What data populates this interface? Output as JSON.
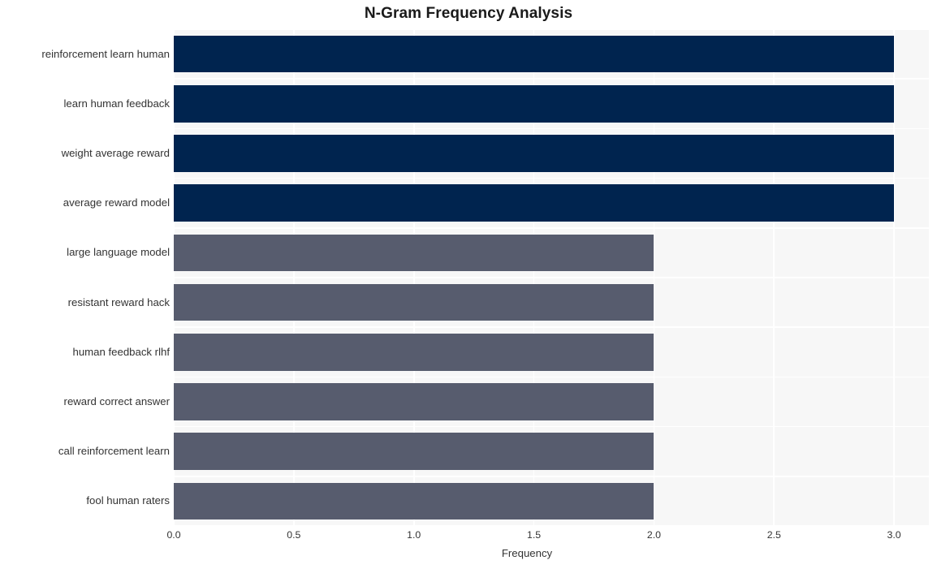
{
  "chart_data": {
    "type": "bar",
    "orientation": "horizontal",
    "title": "N-Gram Frequency Analysis",
    "xlabel": "Frequency",
    "ylabel": "",
    "categories": [
      "reinforcement learn human",
      "learn human feedback",
      "weight average reward",
      "average reward model",
      "large language model",
      "resistant reward hack",
      "human feedback rlhf",
      "reward correct answer",
      "call reinforcement learn",
      "fool human raters"
    ],
    "values": [
      3,
      3,
      3,
      3,
      2,
      2,
      2,
      2,
      2,
      2
    ],
    "bar_colors": [
      "#00244f",
      "#00244f",
      "#00244f",
      "#00244f",
      "#575c6e",
      "#575c6e",
      "#575c6e",
      "#575c6e",
      "#575c6e",
      "#575c6e"
    ],
    "xlim": [
      0.0,
      3.145
    ],
    "xticks": [
      0.0,
      0.5,
      1.0,
      1.5,
      2.0,
      2.5,
      3.0
    ],
    "xtick_labels": [
      "0.0",
      "0.5",
      "1.0",
      "1.5",
      "2.0",
      "2.5",
      "3.0"
    ],
    "grid": true,
    "grid_color": "#ffffff",
    "legend": false,
    "plot_background": "#f7f7f7",
    "figure_background": "#ffffff",
    "colors": {
      "high_value_bar": "#00244f",
      "low_value_bar": "#575c6e",
      "text": "#333333",
      "title": "#1a1a1a"
    }
  }
}
